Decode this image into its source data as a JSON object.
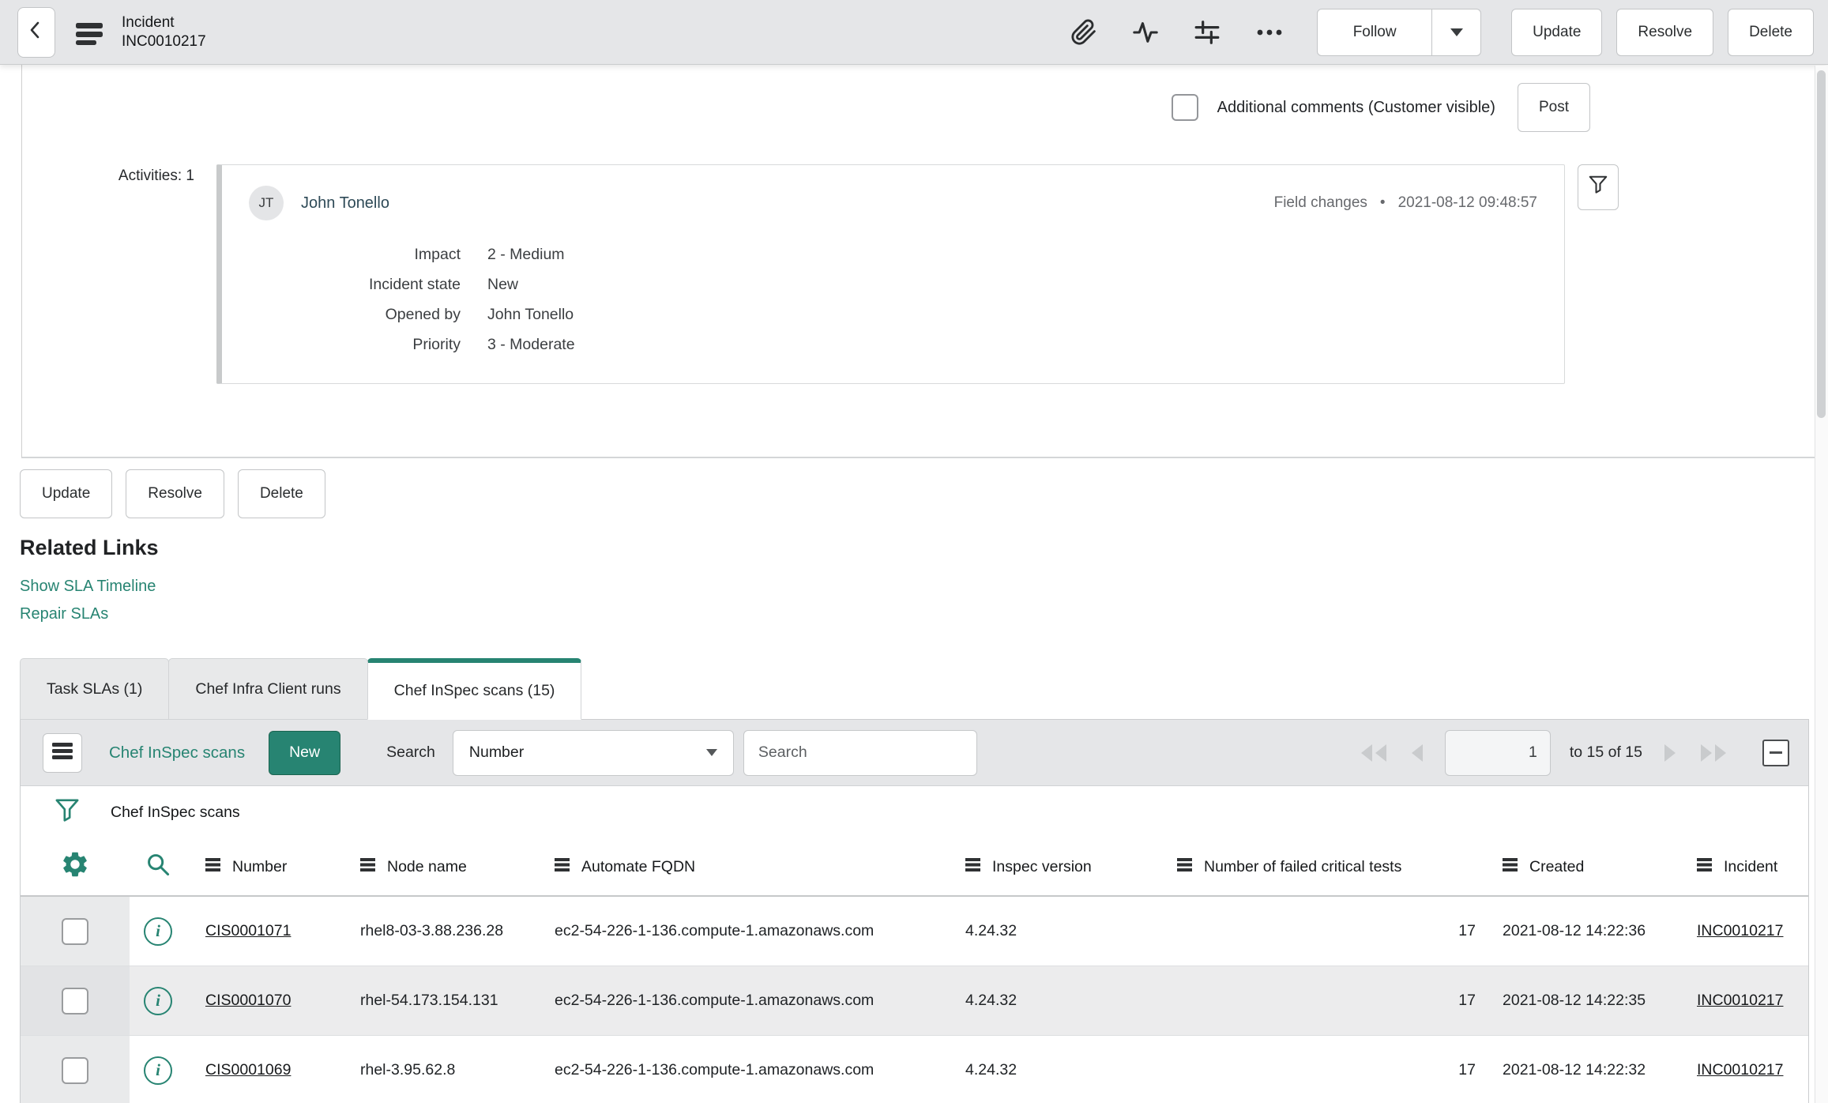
{
  "colors": {
    "accent": "#278472",
    "header_bg": "#e5e6e8",
    "row_alt": "#ececed",
    "muted_text": "#67696d"
  },
  "header": {
    "title_line1": "Incident",
    "title_line2": "INC0010217",
    "follow_label": "Follow",
    "update_label": "Update",
    "resolve_label": "Resolve",
    "delete_label": "Delete"
  },
  "comments": {
    "label": "Additional comments (Customer visible)",
    "post_label": "Post"
  },
  "activities": {
    "label": "Activities: 1",
    "entry": {
      "avatar_initials": "JT",
      "author": "John Tonello",
      "type": "Field changes",
      "separator": "•",
      "timestamp": "2021-08-12 09:48:57",
      "fields": [
        {
          "label": "Impact",
          "value": "2 - Medium"
        },
        {
          "label": "Incident state",
          "value": "New"
        },
        {
          "label": "Opened by",
          "value": "John Tonello"
        },
        {
          "label": "Priority",
          "value": "3 - Moderate"
        }
      ]
    }
  },
  "form_buttons": {
    "update": "Update",
    "resolve": "Resolve",
    "delete": "Delete"
  },
  "related_links": {
    "heading": "Related Links",
    "links": [
      "Show SLA Timeline",
      "Repair SLAs"
    ]
  },
  "tabs": [
    {
      "label": "Task SLAs (1)"
    },
    {
      "label": "Chef Infra Client runs"
    },
    {
      "label": "Chef InSpec scans (15)"
    }
  ],
  "list": {
    "title": "Chef InSpec scans",
    "new_label": "New",
    "search_label": "Search",
    "search_field": "Number",
    "search_placeholder": "Search",
    "pagination": {
      "page": "1",
      "range": "to 15 of 15"
    },
    "breadcrumb": "Chef InSpec scans",
    "columns": [
      "Number",
      "Node name",
      "Automate FQDN",
      "Inspec version",
      "Number of failed critical tests",
      "Created",
      "Incident"
    ],
    "rows": [
      {
        "number": "CIS0001071",
        "node_name": "rhel8-03-3.88.236.28",
        "automate_fqdn": "ec2-54-226-1-136.compute-1.amazonaws.com",
        "inspec_version": "4.24.32",
        "failed_critical_tests": "17",
        "created": "2021-08-12 14:22:36",
        "incident": "INC0010217"
      },
      {
        "number": "CIS0001070",
        "node_name": "rhel-54.173.154.131",
        "automate_fqdn": "ec2-54-226-1-136.compute-1.amazonaws.com",
        "inspec_version": "4.24.32",
        "failed_critical_tests": "17",
        "created": "2021-08-12 14:22:35",
        "incident": "INC0010217"
      },
      {
        "number": "CIS0001069",
        "node_name": "rhel-3.95.62.8",
        "automate_fqdn": "ec2-54-226-1-136.compute-1.amazonaws.com",
        "inspec_version": "4.24.32",
        "failed_critical_tests": "17",
        "created": "2021-08-12 14:22:32",
        "incident": "INC0010217"
      }
    ]
  }
}
